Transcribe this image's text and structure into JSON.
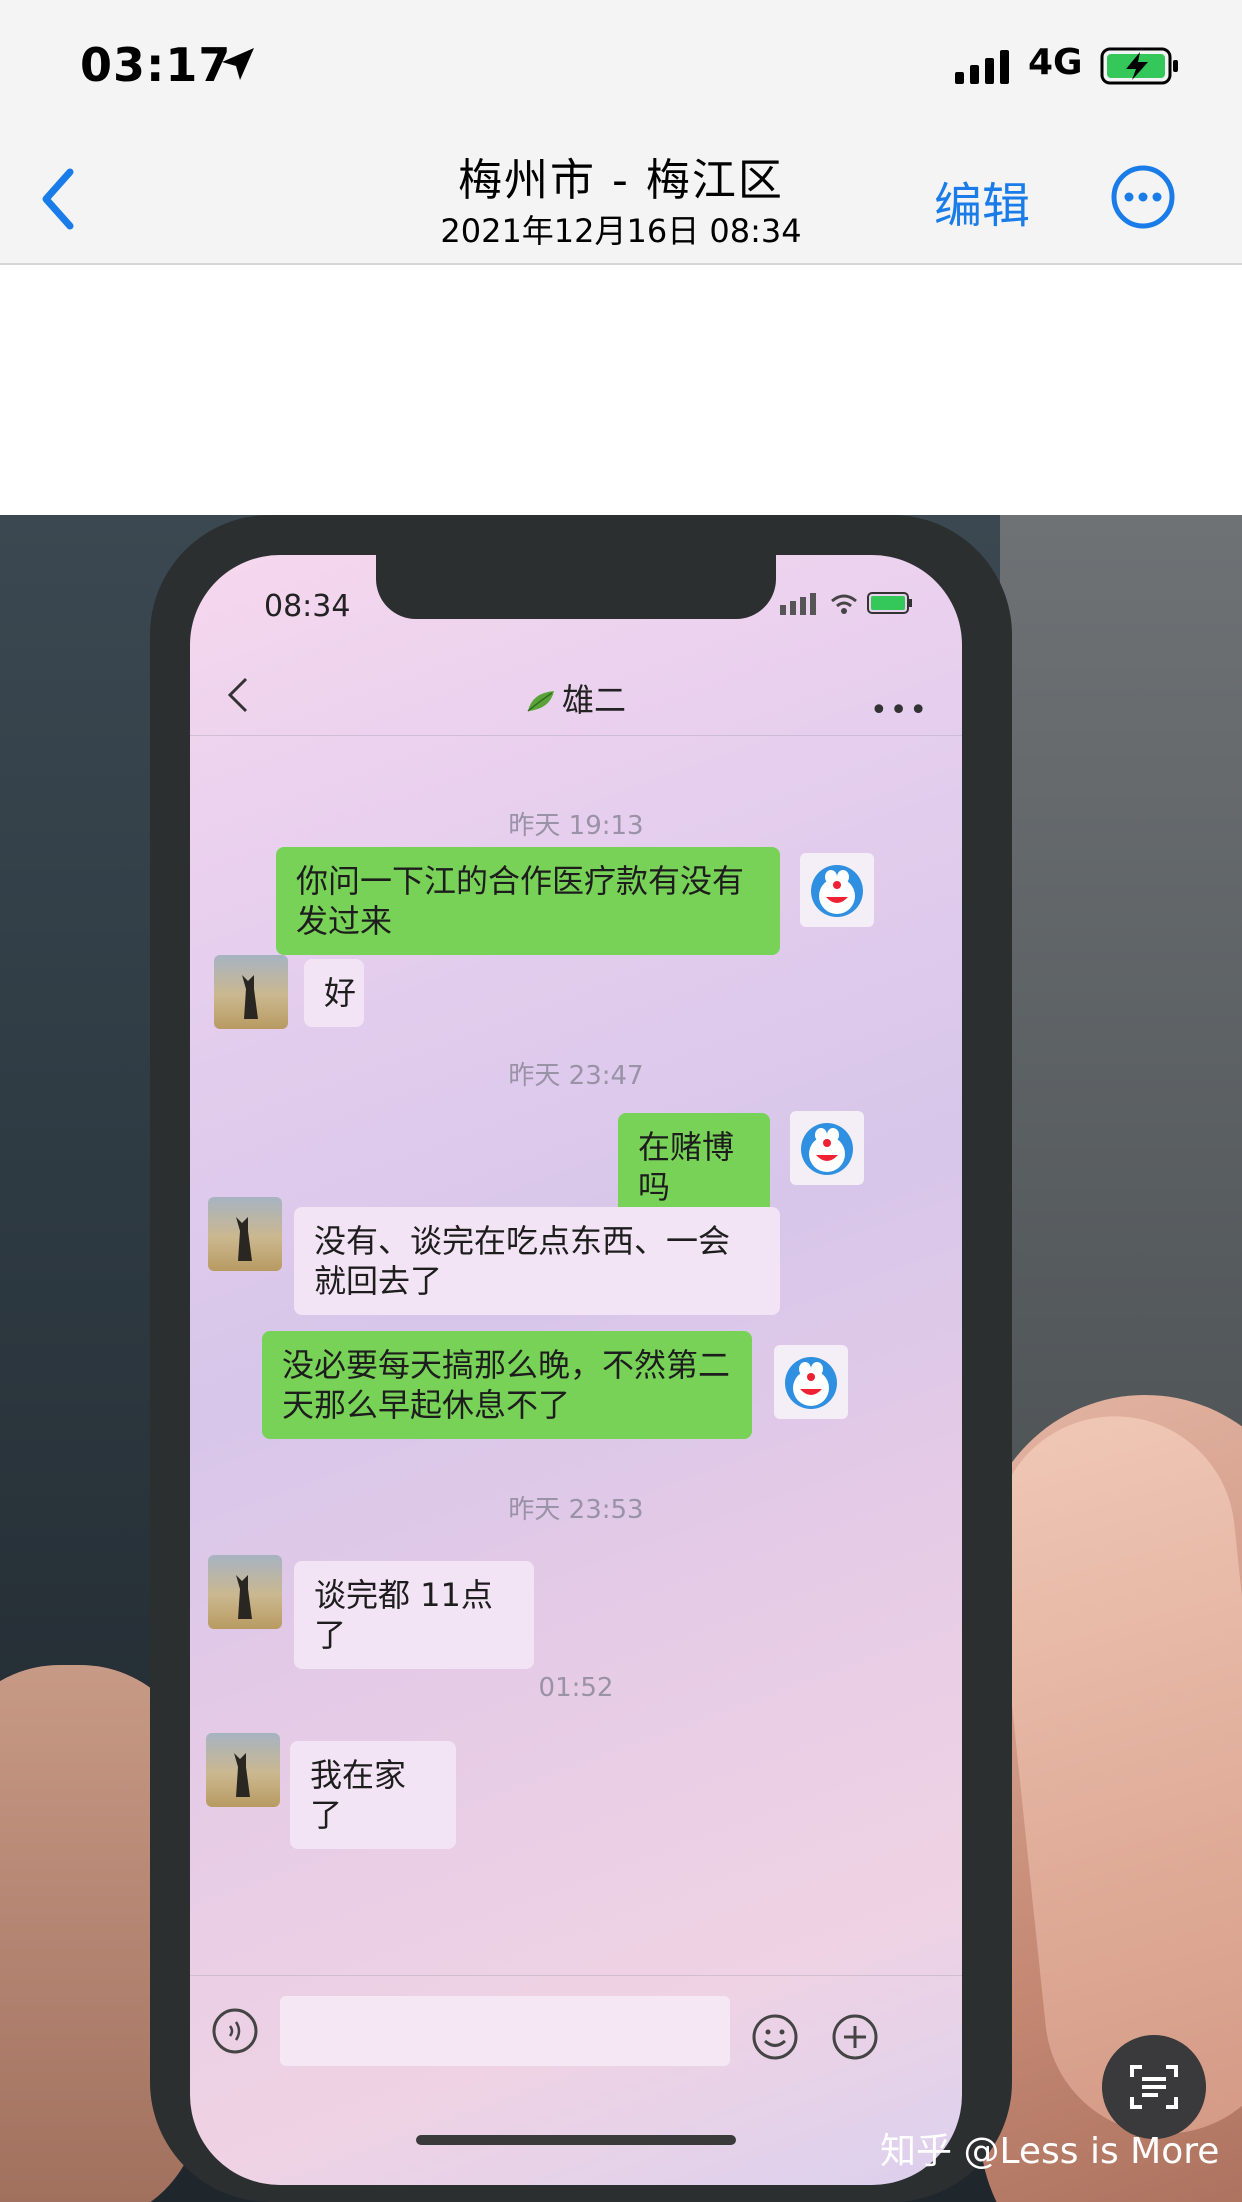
{
  "status_bar": {
    "time": "03:17",
    "network": "4G",
    "icons": [
      "location-arrow-icon",
      "signal-bars-icon",
      "battery-charging-icon"
    ]
  },
  "nav": {
    "title": "梅州市 - 梅江区",
    "subtitle": "2021年12月16日  08:34",
    "edit_label": "编辑",
    "back_icon": "chevron-left-icon",
    "more_icon": "more-circle-icon",
    "accent": "#1a7ce8"
  },
  "photo": {
    "phone_status_time": "08:34",
    "chat_title": "雄二",
    "messages": [
      {
        "type": "time",
        "text": "昨天 19:13"
      },
      {
        "type": "sent",
        "text": "你问一下江的合作医疗款有没有发过来"
      },
      {
        "type": "received",
        "text": "好"
      },
      {
        "type": "time",
        "text": "昨天 23:47"
      },
      {
        "type": "sent",
        "text": "在赌博吗"
      },
      {
        "type": "received",
        "text": "没有、谈完在吃点东西、一会就回去了"
      },
      {
        "type": "sent",
        "text": "没必要每天搞那么晚，不然第二天那么早起休息不了"
      },
      {
        "type": "time",
        "text": "昨天 23:53"
      },
      {
        "type": "received",
        "text": "谈完都 11点了"
      },
      {
        "type": "time",
        "text": "01:52"
      },
      {
        "type": "received",
        "text": "我在家了"
      }
    ],
    "sent_bubble_color": "#78d258",
    "watermark": "知乎 @Less is More"
  }
}
